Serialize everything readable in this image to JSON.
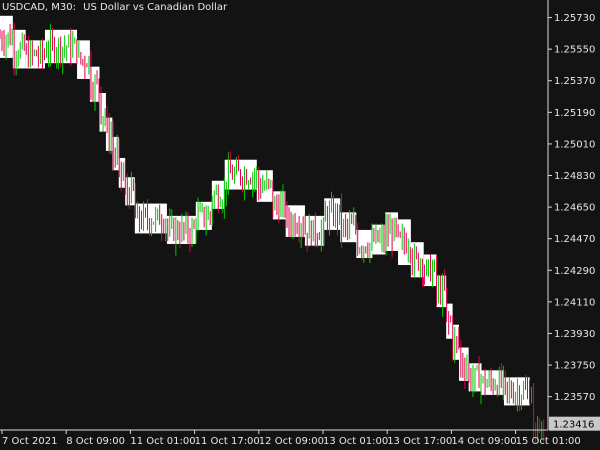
{
  "window": {
    "symbol_timeframe": "USDCAD, M30:",
    "description": "US Dollar vs Canadian Dollar"
  },
  "colors": {
    "background": "#131313",
    "axis": "#d8d8d8",
    "text": "#e6e6e6",
    "bull_candle": "#00c800",
    "bear_candle": "#e0004a",
    "indicator_band": "#ffffff",
    "price_tag_bg": "#c8c8c8",
    "price_tag_text": "#000000"
  },
  "chart_data": {
    "type": "candlestick-with-stepped-band",
    "y_axis_labels": [
      "1.25730",
      "1.25550",
      "1.25370",
      "1.25190",
      "1.25010",
      "1.24830",
      "1.24650",
      "1.24470",
      "1.24290",
      "1.24110",
      "1.23930",
      "1.23750",
      "1.23570"
    ],
    "ylim": [
      1.2338,
      1.2583
    ],
    "x_axis_labels": [
      "7 Oct 2021",
      "8 Oct 09:00",
      "11 Oct 01:00",
      "11 Oct 17:00",
      "12 Oct 09:00",
      "13 Oct 01:00",
      "13 Oct 17:00",
      "14 Oct 09:00",
      "15 Oct 01:00"
    ],
    "current_price": "1.23416",
    "band_steps": [
      {
        "x0": 0.0,
        "x1": 0.2,
        "top": 1.2574,
        "bottom": 1.255
      },
      {
        "x0": 0.2,
        "x1": 0.4,
        "top": 1.2566,
        "bottom": 1.2544
      },
      {
        "x0": 0.4,
        "x1": 0.7,
        "top": 1.256,
        "bottom": 1.2544
      },
      {
        "x0": 0.7,
        "x1": 1.2,
        "top": 1.2566,
        "bottom": 1.2547
      },
      {
        "x0": 1.2,
        "x1": 1.4,
        "top": 1.256,
        "bottom": 1.2538
      },
      {
        "x0": 1.4,
        "x1": 1.55,
        "top": 1.2545,
        "bottom": 1.2525
      },
      {
        "x0": 1.55,
        "x1": 1.65,
        "top": 1.253,
        "bottom": 1.2508
      },
      {
        "x0": 1.65,
        "x1": 1.75,
        "top": 1.2516,
        "bottom": 1.2497
      },
      {
        "x0": 1.75,
        "x1": 1.85,
        "top": 1.2505,
        "bottom": 1.2486
      },
      {
        "x0": 1.85,
        "x1": 1.95,
        "top": 1.2493,
        "bottom": 1.2476
      },
      {
        "x0": 1.95,
        "x1": 2.1,
        "top": 1.2482,
        "bottom": 1.2466
      },
      {
        "x0": 2.1,
        "x1": 2.6,
        "top": 1.2467,
        "bottom": 1.245
      },
      {
        "x0": 2.6,
        "x1": 3.05,
        "top": 1.246,
        "bottom": 1.2444
      },
      {
        "x0": 3.05,
        "x1": 3.3,
        "top": 1.2468,
        "bottom": 1.2452
      },
      {
        "x0": 3.3,
        "x1": 3.5,
        "top": 1.248,
        "bottom": 1.2464
      },
      {
        "x0": 3.5,
        "x1": 4.0,
        "top": 1.2492,
        "bottom": 1.2475
      },
      {
        "x0": 4.0,
        "x1": 4.25,
        "top": 1.2486,
        "bottom": 1.2468
      },
      {
        "x0": 4.25,
        "x1": 4.45,
        "top": 1.2474,
        "bottom": 1.2458
      },
      {
        "x0": 4.45,
        "x1": 4.75,
        "top": 1.2466,
        "bottom": 1.2448
      },
      {
        "x0": 4.75,
        "x1": 5.05,
        "top": 1.246,
        "bottom": 1.2443
      },
      {
        "x0": 5.05,
        "x1": 5.3,
        "top": 1.247,
        "bottom": 1.2452
      },
      {
        "x0": 5.3,
        "x1": 5.55,
        "top": 1.2462,
        "bottom": 1.2445
      },
      {
        "x0": 5.55,
        "x1": 5.8,
        "top": 1.2452,
        "bottom": 1.2436
      },
      {
        "x0": 5.8,
        "x1": 6.0,
        "top": 1.2455,
        "bottom": 1.2438
      },
      {
        "x0": 6.0,
        "x1": 6.2,
        "top": 1.2462,
        "bottom": 1.244
      },
      {
        "x0": 6.2,
        "x1": 6.4,
        "top": 1.2458,
        "bottom": 1.2432
      },
      {
        "x0": 6.4,
        "x1": 6.6,
        "top": 1.2445,
        "bottom": 1.2425
      },
      {
        "x0": 6.6,
        "x1": 6.8,
        "top": 1.2438,
        "bottom": 1.242
      },
      {
        "x0": 6.8,
        "x1": 6.95,
        "top": 1.2426,
        "bottom": 1.2408
      },
      {
        "x0": 6.95,
        "x1": 7.05,
        "top": 1.241,
        "bottom": 1.239
      },
      {
        "x0": 7.05,
        "x1": 7.15,
        "top": 1.2398,
        "bottom": 1.2378
      },
      {
        "x0": 7.15,
        "x1": 7.3,
        "top": 1.2385,
        "bottom": 1.2366
      },
      {
        "x0": 7.3,
        "x1": 7.5,
        "top": 1.2376,
        "bottom": 1.236
      },
      {
        "x0": 7.5,
        "x1": 7.85,
        "top": 1.2372,
        "bottom": 1.2358
      },
      {
        "x0": 7.85,
        "x1": 8.25,
        "top": 1.2368,
        "bottom": 1.2352
      }
    ]
  }
}
